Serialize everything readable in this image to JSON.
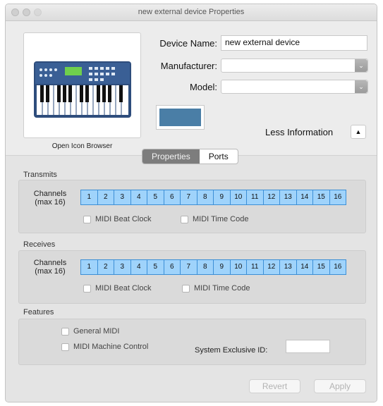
{
  "window": {
    "title": "new external device Properties"
  },
  "icon_area": {
    "caption": "Open Icon Browser"
  },
  "fields": {
    "device_name_label": "Device Name:",
    "device_name_value": "new external device",
    "manufacturer_label": "Manufacturer:",
    "manufacturer_value": "",
    "model_label": "Model:",
    "model_value": ""
  },
  "color_well": {
    "color": "#4a7ea6"
  },
  "less_information": {
    "label": "Less Information"
  },
  "tabs": [
    {
      "label": "Properties",
      "selected": true
    },
    {
      "label": "Ports",
      "selected": false
    }
  ],
  "transmits": {
    "title": "Transmits",
    "channels_label_1": "Channels",
    "channels_label_2": "(max 16)",
    "channels": [
      "1",
      "2",
      "3",
      "4",
      "5",
      "6",
      "7",
      "8",
      "9",
      "10",
      "11",
      "12",
      "13",
      "14",
      "15",
      "16"
    ],
    "beat_clock": "MIDI Beat Clock",
    "time_code": "MIDI Time Code"
  },
  "receives": {
    "title": "Receives",
    "channels_label_1": "Channels",
    "channels_label_2": "(max 16)",
    "channels": [
      "1",
      "2",
      "3",
      "4",
      "5",
      "6",
      "7",
      "8",
      "9",
      "10",
      "11",
      "12",
      "13",
      "14",
      "15",
      "16"
    ],
    "beat_clock": "MIDI Beat Clock",
    "time_code": "MIDI Time Code"
  },
  "features": {
    "title": "Features",
    "general_midi": "General MIDI",
    "machine_control": "MIDI Machine Control",
    "sysex_label": "System Exclusive ID:",
    "sysex_value": ""
  },
  "buttons": {
    "revert": "Revert",
    "apply": "Apply"
  },
  "colors": {
    "channel_fill": "#9fd3fb",
    "channel_border": "#3d8fd6",
    "segment_selected": "#7d7d7d"
  }
}
